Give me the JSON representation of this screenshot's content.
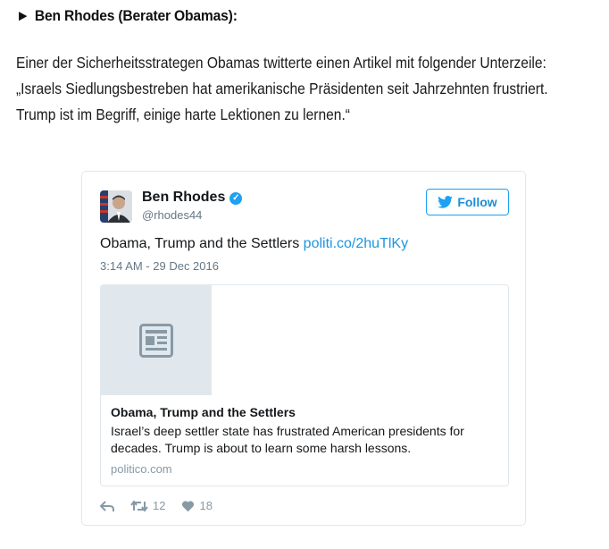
{
  "heading": {
    "marker": "►",
    "text": "Ben Rhodes (Berater Obamas):"
  },
  "intro": {
    "lines": [
      "Einer der Sicherheitsstrategen Obamas twitterte einen Artikel mit folgender Unterzeile:",
      "„Israels Siedlungsbestreben hat amerikanische Präsidenten seit Jahrzehnten frustriert.",
      "Trump ist im Begriff, einige harte Lektionen zu lernen.“"
    ]
  },
  "tweet": {
    "author_name": "Ben Rhodes",
    "verified_icon": "verified-badge-icon",
    "handle": "@rhodes44",
    "follow_label": "Follow",
    "text": "Obama, Trump and the Settlers",
    "link": "politi.co/2huTlKy",
    "timestamp": "3:14 AM - 29 Dec 2016",
    "card": {
      "title": "Obama, Trump and the Settlers",
      "description": "Israel’s deep settler state has frustrated American presidents for decades. Trump is about to learn some harsh lessons.",
      "domain": "politico.com"
    },
    "actions": {
      "retweets": "12",
      "likes": "18"
    }
  },
  "colors": {
    "twitter_blue": "#1da1f2",
    "muted": "#8899a6",
    "card_thumb": "#e1e8ed"
  }
}
